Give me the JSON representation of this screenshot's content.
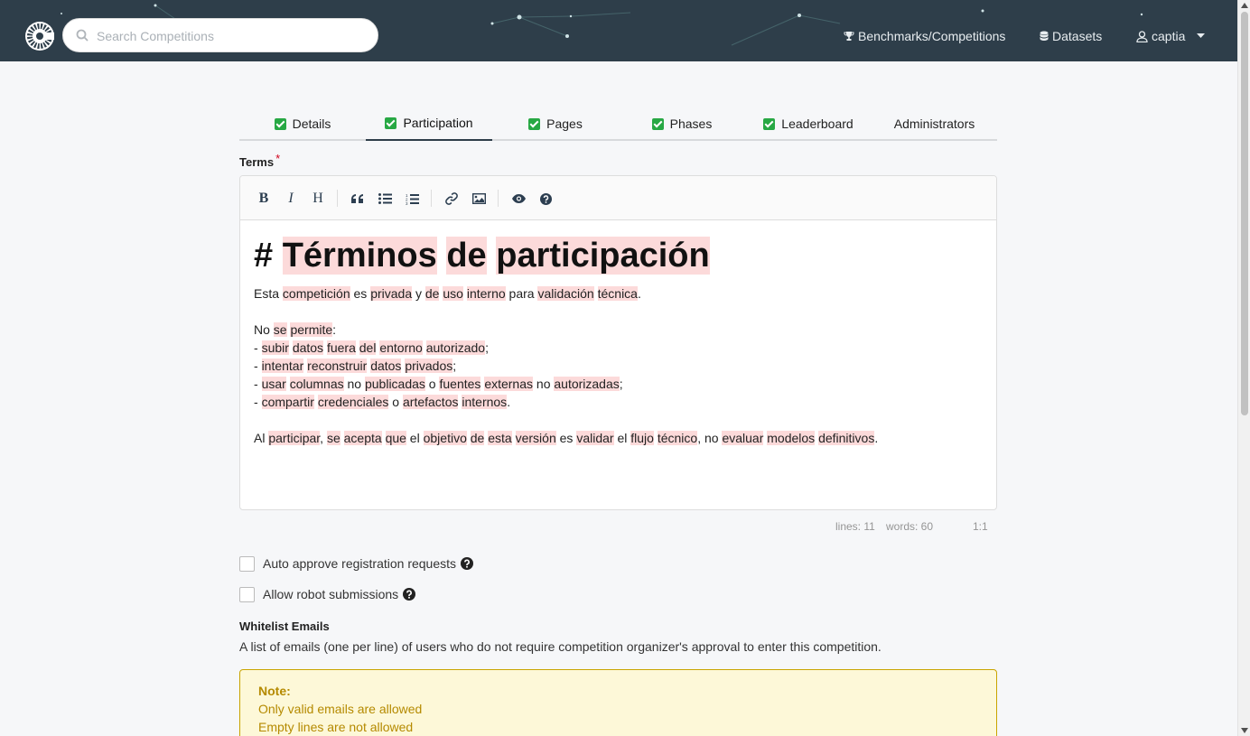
{
  "topbar": {
    "search_placeholder": "Search Competitions",
    "nav": {
      "benchmarks": "Benchmarks/Competitions",
      "datasets": "Datasets",
      "user": "captia"
    }
  },
  "tabs": [
    {
      "label": "Details",
      "checked": true
    },
    {
      "label": "Participation",
      "checked": true,
      "active": true
    },
    {
      "label": "Pages",
      "checked": true
    },
    {
      "label": "Phases",
      "checked": true
    },
    {
      "label": "Leaderboard",
      "checked": true
    },
    {
      "label": "Administrators",
      "checked": false
    }
  ],
  "terms": {
    "label": "Terms",
    "required_mark": "*"
  },
  "editor": {
    "toolbar": {
      "bold": "B",
      "italic": "I",
      "heading": "H"
    },
    "status": {
      "lines": "lines: 11",
      "words": "words: 60",
      "cursor": "1:1"
    }
  },
  "options": {
    "auto_approve": "Auto approve registration requests",
    "allow_robot": "Allow robot submissions"
  },
  "whitelist": {
    "title": "Whitelist Emails",
    "description": "A list of emails (one per line) of users who do not require competition organizer's approval to enter this competition."
  },
  "note": {
    "title": "Note:",
    "lines": [
      "Only valid emails are allowed",
      "Empty lines are not allowed"
    ]
  }
}
